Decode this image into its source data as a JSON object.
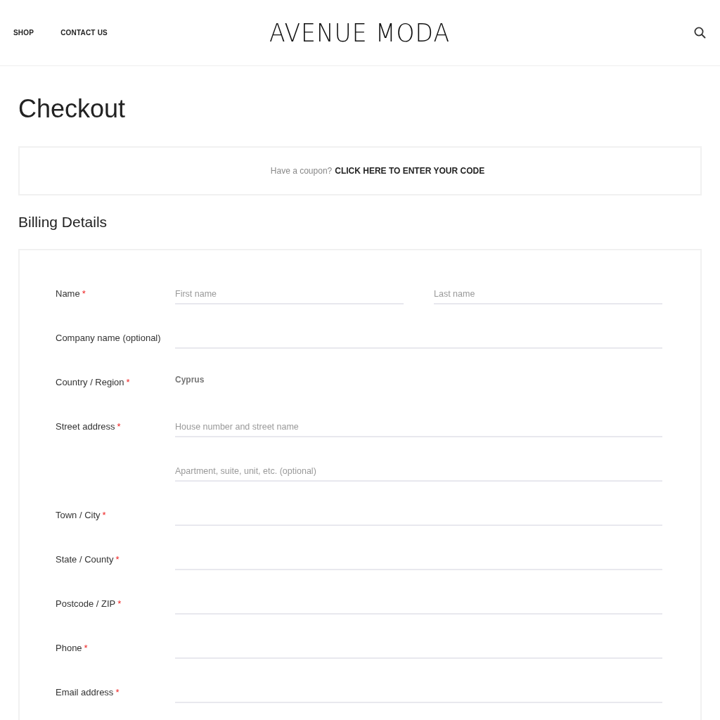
{
  "nav": [
    {
      "label": "SHOP"
    },
    {
      "label": "CONTACT US"
    }
  ],
  "logo": "AVENUE MODA",
  "page_title": "Checkout",
  "coupon": {
    "prompt": "Have a coupon?",
    "link": "CLICK HERE TO ENTER YOUR CODE"
  },
  "billing": {
    "title": "Billing Details",
    "rows": [
      {
        "kind": "fields",
        "label": "Name",
        "mark": "*",
        "fields": [
          {
            "placeholder": "First name"
          },
          {
            "placeholder": "Last name"
          }
        ]
      },
      {
        "kind": "blank",
        "label": "Company name (optional)"
      },
      {
        "kind": "static",
        "label": "Country / Region",
        "mark": "*",
        "value": "Cyprus"
      },
      {
        "kind": "fields",
        "label": "Street address",
        "mark": "*",
        "fields": [
          {
            "placeholder": "House number and street name"
          }
        ]
      },
      {
        "kind": "fields",
        "fields": [
          {
            "placeholder": "Apartment, suite, unit, etc. (optional)"
          }
        ]
      },
      {
        "kind": "blank",
        "label": "Town / City",
        "mark": "*"
      },
      {
        "kind": "blank",
        "label": "State / County",
        "mark": "*"
      },
      {
        "kind": "blank",
        "label": "Postcode / ZIP",
        "mark": "*"
      },
      {
        "kind": "blank",
        "label": "Phone",
        "mark": "*"
      },
      {
        "kind": "blank",
        "label": "Email address",
        "mark": "*"
      }
    ]
  }
}
